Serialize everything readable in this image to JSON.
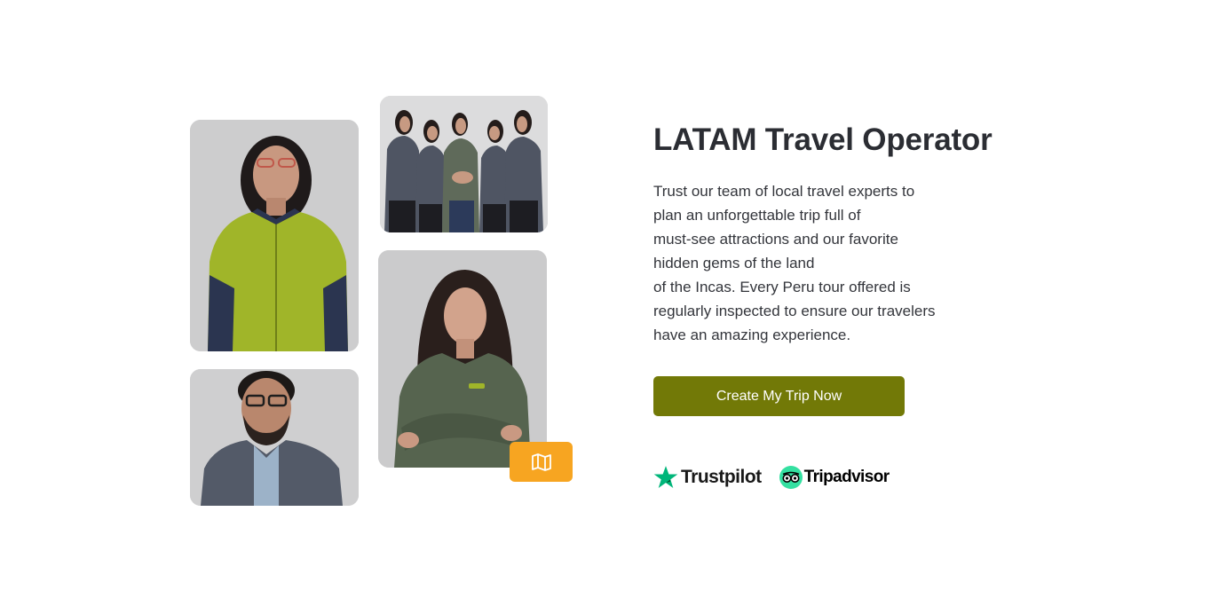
{
  "section": {
    "title": "LATAM Travel Operator",
    "description_lines": [
      "Trust our team of local travel experts to",
      "plan an unforgettable trip full of",
      "must-see attractions and our favorite",
      "hidden gems of the land",
      "of the Incas. Every Peru tour offered is",
      "regularly inspected to ensure our travelers",
      "have an amazing experience."
    ],
    "cta_label": "Create My Trip Now"
  },
  "photos": [
    {
      "name": "woman-green-jacket"
    },
    {
      "name": "team-group"
    },
    {
      "name": "woman-gray-shirt"
    },
    {
      "name": "man-glasses"
    }
  ],
  "badge": {
    "icon": "map-icon"
  },
  "reviews": {
    "trustpilot_label": "Trustpilot",
    "tripadvisor_label": "Tripadvisor"
  },
  "colors": {
    "cta": "#727907",
    "badge": "#f7a521",
    "trustpilot_star": "#00b67a",
    "tripadvisor_logo": "#34e0a1",
    "heading": "#2b2d33"
  }
}
